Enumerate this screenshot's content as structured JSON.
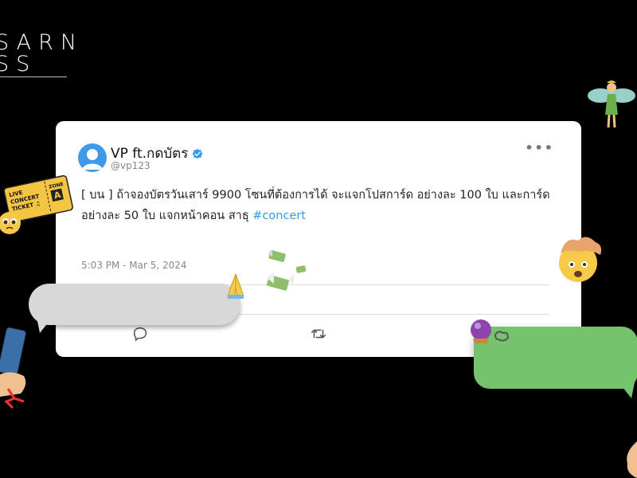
{
  "brand": {
    "line1": "SARN",
    "line2": "SS"
  },
  "tweet": {
    "display_name": "VP ft.กดบัตร",
    "handle": "@vp123",
    "text_main": "[ บน ] ถ้าจองบัตรวันเสาร์ 9900 โซนที่ต้องการได้ จะแจกโปสการ์ด อย่างละ 100 ใบ และการ์ด อย่างละ 50 ใบ แจกหน้าคอน สาธุ ",
    "hashtag": "#concert",
    "timestamp": "5:03 PM - Mar 5, 2024",
    "more_label": "•••",
    "verified_icon": "verified-badge-icon",
    "actions": [
      "comment-icon",
      "retweet-icon",
      "heart-icon"
    ]
  },
  "ticket": {
    "line1": "LIVE",
    "line2": "CONCERT",
    "line3": "TICKET ♫",
    "zone_label": "ZONE",
    "zone_value": "A"
  },
  "colors": {
    "background": "#000000",
    "card": "#ffffff",
    "accent_blue": "#2d9cf0",
    "bubble_gray": "#d8d8d8",
    "bubble_green": "#75c36d"
  }
}
